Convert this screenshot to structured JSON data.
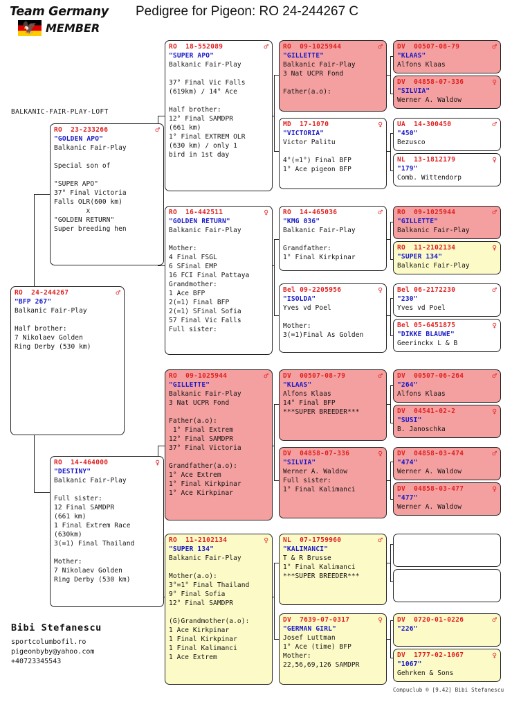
{
  "header": {
    "logo_team": "Team Germany",
    "logo_member": "MEMBER",
    "title": "Pedigree for Pigeon: RO  24-244267 C",
    "loft": "BALKANIC-FAIR-PLAY-LOFT"
  },
  "footer": {
    "owner_name": "Bibi Stefanescu",
    "website": "sportcolumbofil.ro",
    "email": "pigeonbyby@yahoo.com",
    "phone": "+40723345543",
    "credit": "Compuclub ® [9.42]  Bibi Stefanescu"
  },
  "symbols": {
    "male": "♂",
    "female": "♀"
  },
  "colors": {
    "ring": "#e02020",
    "name": "#1818c8",
    "pink": "#f4a0a0",
    "yellow": "#fcfbc8",
    "white": "#ffffff"
  },
  "cards": {
    "subject": {
      "ring": "RO  24-244267",
      "sex": "♂",
      "name": "\"BFP 267\"",
      "body": "Balkanic Fair-Play\n\nHalf brother:\n7 Nikolaev Golden\nRing Derby (530 km)",
      "color": "white"
    },
    "sire": {
      "ring": "RO  23-233266",
      "sex": "♂",
      "name": "\"GOLDEN APO\"",
      "body": "Balkanic Fair-Play\n\nSpecial son of\n\n\"SUPER APO\"\n37° Final Victoria\nFalls OLR(600 km)\n        x\n\"GOLDEN RETURN\"\nSuper breeding hen",
      "color": "white"
    },
    "dam": {
      "ring": "RO  14-464000",
      "sex": "♀",
      "name": "\"DESTINY\"",
      "body": "Balkanic Fair-Play\n\nFull sister:\n12 Final SAMDPR\n(661 km)\n1 Final Extrem Race\n(630km)\n3(=1) Final Thailand\n\nMother:\n7 Nikolaev Golden\nRing Derby (530 km)",
      "color": "white"
    },
    "g2": [
      {
        "ring": "RO  18-552089",
        "sex": "♂",
        "name": "\"SUPER APO\"",
        "body": "Balkanic Fair-Play\n\n37° Final Vic Falls\n(619km) / 14° Ace\n\nHalf brother:\n12° Final SAMDPR\n(661 km)\n1° Final EXTREM OLR\n(630 km) / only 1\nbird in 1st day",
        "color": "white"
      },
      {
        "ring": "RO  16-442511",
        "sex": "♀",
        "name": "\"GOLDEN RETURN\"",
        "body": "Balkanic Fair-Play\n\nMother:\n4 Final FSGL\n6 SFinal EMP\n16 FCI Final Pattaya\nGrandmother:\n1 Ace BFP\n2(=1) Final BFP\n2(=1) SFinal Sofia\n57 Final Vic Falls\nFull sister:",
        "color": "white"
      },
      {
        "ring": "RO  09-1025944",
        "sex": "♂",
        "name": "\"GILLETTE\"",
        "body": "Balkanic Fair-Play\n3 Nat UCPR Fond\n\nFather(a.o):\n 1° Final Extrem\n12° Final SAMDPR\n37° Final Victoria\n\nGrandfather(a.o):\n1° Ace Extrem\n1° Final Kirkpinar\n1° Ace Kirkpinar",
        "color": "pink"
      },
      {
        "ring": "RO  11-2102134",
        "sex": "♀",
        "name": "\"SUPER 134\"",
        "body": "Balkanic Fair-Play\n\nMother(a.o):\n3°=1° Final Thailand\n9° Final Sofia\n12° Final SAMDPR\n\n(G)Grandmother(a.o):\n1 Ace Kirkpinar\n1 Final Kirkpinar\n1 Final Kalimanci\n1 Ace Extrem",
        "color": "yellow"
      }
    ],
    "g3": [
      {
        "ring": "RO  09-1025944",
        "sex": "♂",
        "name": "\"GILLETTE\"",
        "body": "Balkanic Fair-Play\n3 Nat UCPR Fond\n\nFather(a.o):",
        "color": "pink"
      },
      {
        "ring": "MD  17-1070",
        "sex": "♀",
        "name": "\"VICTORIA\"",
        "body": "Victor Palitu\n\n4°(=1°) Final BFP\n1° Ace pigeon BFP",
        "color": "white"
      },
      {
        "ring": "RO  14-465036",
        "sex": "♂",
        "name": "\"KMG 036\"",
        "body": "Balkanic Fair-Play\n\nGrandfather:\n1° Final Kirkpinar",
        "color": "white"
      },
      {
        "ring": "Bel 09-2205956",
        "sex": "♀",
        "name": "\"ISOLDA\"",
        "body": "Yves vd Poel\n\nMother:\n3(=1)Final As Golden",
        "color": "white"
      },
      {
        "ring": "DV  00507-08-79",
        "sex": "♂",
        "name": "\"KLAAS\"",
        "body": "Alfons Klaas\n14° Final BFP\n***SUPER BREEDER***",
        "color": "pink"
      },
      {
        "ring": "DV  04858-07-336",
        "sex": "♀",
        "name": "\"SILVIA\"",
        "body": "Werner A. Waldow\nFull sister:\n1° Final Kalimanci",
        "color": "pink"
      },
      {
        "ring": "NL  07-1759960",
        "sex": "♂",
        "name": "\"KALIMANCI\"",
        "body": "T & R Brusse\n1° Final Kalimanci\n***SUPER BREEDER***",
        "color": "yellow"
      },
      {
        "ring": "DV  7639-07-0317",
        "sex": "♀",
        "name": "\"GERMAN GIRL\"",
        "body": "Josef Luttman\n1° Ace (time) BFP\nMother:\n22,56,69,126 SAMDPR",
        "color": "yellow"
      }
    ],
    "g4": [
      {
        "ring": "DV  00507-08-79",
        "sex": "♂",
        "name": "\"KLAAS\"",
        "body": "Alfons Klaas",
        "color": "pink"
      },
      {
        "ring": "DV  04858-07-336",
        "sex": "♀",
        "name": "\"SILVIA\"",
        "body": "Werner A. Waldow",
        "color": "pink"
      },
      {
        "ring": "UA  14-300450",
        "sex": "♂",
        "name": "\"450\"",
        "body": "Bezusco",
        "color": "white"
      },
      {
        "ring": "NL  13-1812179",
        "sex": "♀",
        "name": "\"179\"",
        "body": "Comb. Wittendorp",
        "color": "white"
      },
      {
        "ring": "RO  09-1025944",
        "sex": "♂",
        "name": "\"GILLETTE\"",
        "body": "Balkanic Fair-Play",
        "color": "pink"
      },
      {
        "ring": "RO  11-2102134",
        "sex": "♀",
        "name": "\"SUPER 134\"",
        "body": "Balkanic Fair-Play",
        "color": "yellow"
      },
      {
        "ring": "Bel 06-2172230",
        "sex": "♂",
        "name": "\"230\"",
        "body": "Yves vd Poel",
        "color": "white"
      },
      {
        "ring": "Bel 05-6451875",
        "sex": "♀",
        "name": "\"DIKKE BLAUWE\"",
        "body": "Geerinckx L & B",
        "color": "white"
      },
      {
        "ring": "DV  00507-06-264",
        "sex": "♂",
        "name": "\"264\"",
        "body": "Alfons Klaas",
        "color": "pink"
      },
      {
        "ring": "DV  04541-02-2",
        "sex": "♀",
        "name": "\"SUSI\"",
        "body": "B. Janoschka",
        "color": "pink"
      },
      {
        "ring": "DV  04858-03-474",
        "sex": "♂",
        "name": "\"474\"",
        "body": "Werner A. Waldow",
        "color": "pink"
      },
      {
        "ring": "DV  04858-03-477",
        "sex": "♀",
        "name": "\"477\"",
        "body": "Werner A. Waldow",
        "color": "pink"
      },
      {
        "ring": "",
        "sex": "",
        "name": "",
        "body": "",
        "color": "empty"
      },
      {
        "ring": "",
        "sex": "",
        "name": "",
        "body": "",
        "color": "empty"
      },
      {
        "ring": "DV  0720-01-0226",
        "sex": "♂",
        "name": "\"226\"",
        "body": "",
        "color": "yellow"
      },
      {
        "ring": "DV  1777-02-1067",
        "sex": "♀",
        "name": "\"1067\"",
        "body": "Gehrken & Sons",
        "color": "yellow"
      }
    ]
  }
}
